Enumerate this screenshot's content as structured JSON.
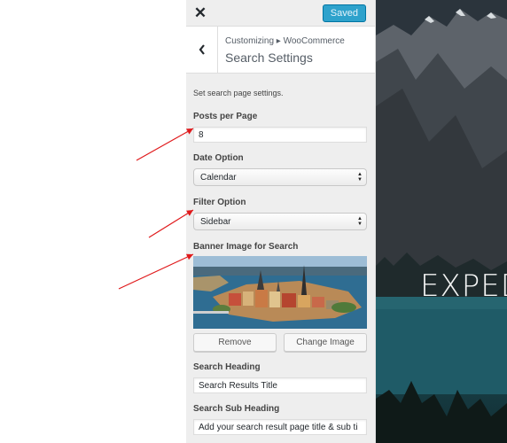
{
  "preview": {
    "hero_text": "EXPED"
  },
  "topbar": {
    "close_glyph": "✕",
    "saved_label": "Saved"
  },
  "header": {
    "breadcrumb": "Customizing ▸ WooCommerce",
    "title": "Search Settings",
    "back_glyph": "‹"
  },
  "section": {
    "description": "Set search page settings.",
    "posts_per_page": {
      "label": "Posts per Page",
      "value": "8"
    },
    "date_option": {
      "label": "Date Option",
      "selected": "Calendar"
    },
    "filter_option": {
      "label": "Filter Option",
      "selected": "Sidebar"
    },
    "banner": {
      "label": "Banner Image for Search",
      "remove_label": "Remove",
      "change_label": "Change Image"
    },
    "search_heading": {
      "label": "Search Heading",
      "value": "Search Results Title"
    },
    "search_sub_heading": {
      "label": "Search Sub Heading",
      "value": "Add your search result page title & sub ti"
    }
  },
  "annotation": {
    "arrow_color": "#e0191b"
  },
  "colors": {
    "accent": "#2ea2cc",
    "panel_bg": "#eeeeee"
  }
}
